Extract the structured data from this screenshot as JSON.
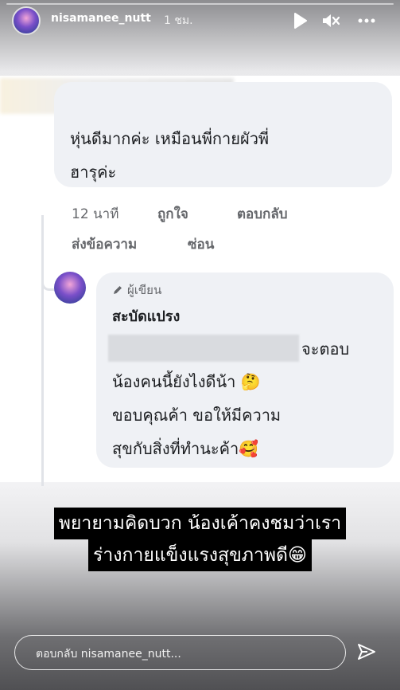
{
  "header": {
    "username": "nisamanee_nutt",
    "time": "1 ชม.",
    "play_icon": "play-icon",
    "mute_icon": "mute-icon",
    "more_icon": "more-icon"
  },
  "comment1": {
    "text_lines": [
      "หุ่นดีมากค่ะ เหมือนพี่กายผัวพี่",
      "ฮารุค่ะ"
    ],
    "actions": {
      "time": "12 นาที",
      "like": "ถูกใจ",
      "reply": "ตอบกลับ",
      "message": "ส่งข้อความ",
      "hide": "ซ่อน"
    }
  },
  "comment2": {
    "author_badge": "ผู้เขียน",
    "name": "สะบัดแปรง",
    "lines": [
      "จะตอบ",
      "น้องคนนี้ยังไงดีน้า 🤔",
      "ขอบคุณค้า ขอให้มีความ",
      "สุขกับสิ่งที่ทำนะค้า🥰"
    ]
  },
  "caption": {
    "line1": "พยายามคิดบวก น้องเค้าคงชมว่าเรา",
    "line2": "ร่างกายแข็งแรงสุขภาพดี😁"
  },
  "reply_bar": {
    "placeholder": "ตอบกลับ nisamanee_nutt...",
    "send_icon": "send-icon"
  }
}
